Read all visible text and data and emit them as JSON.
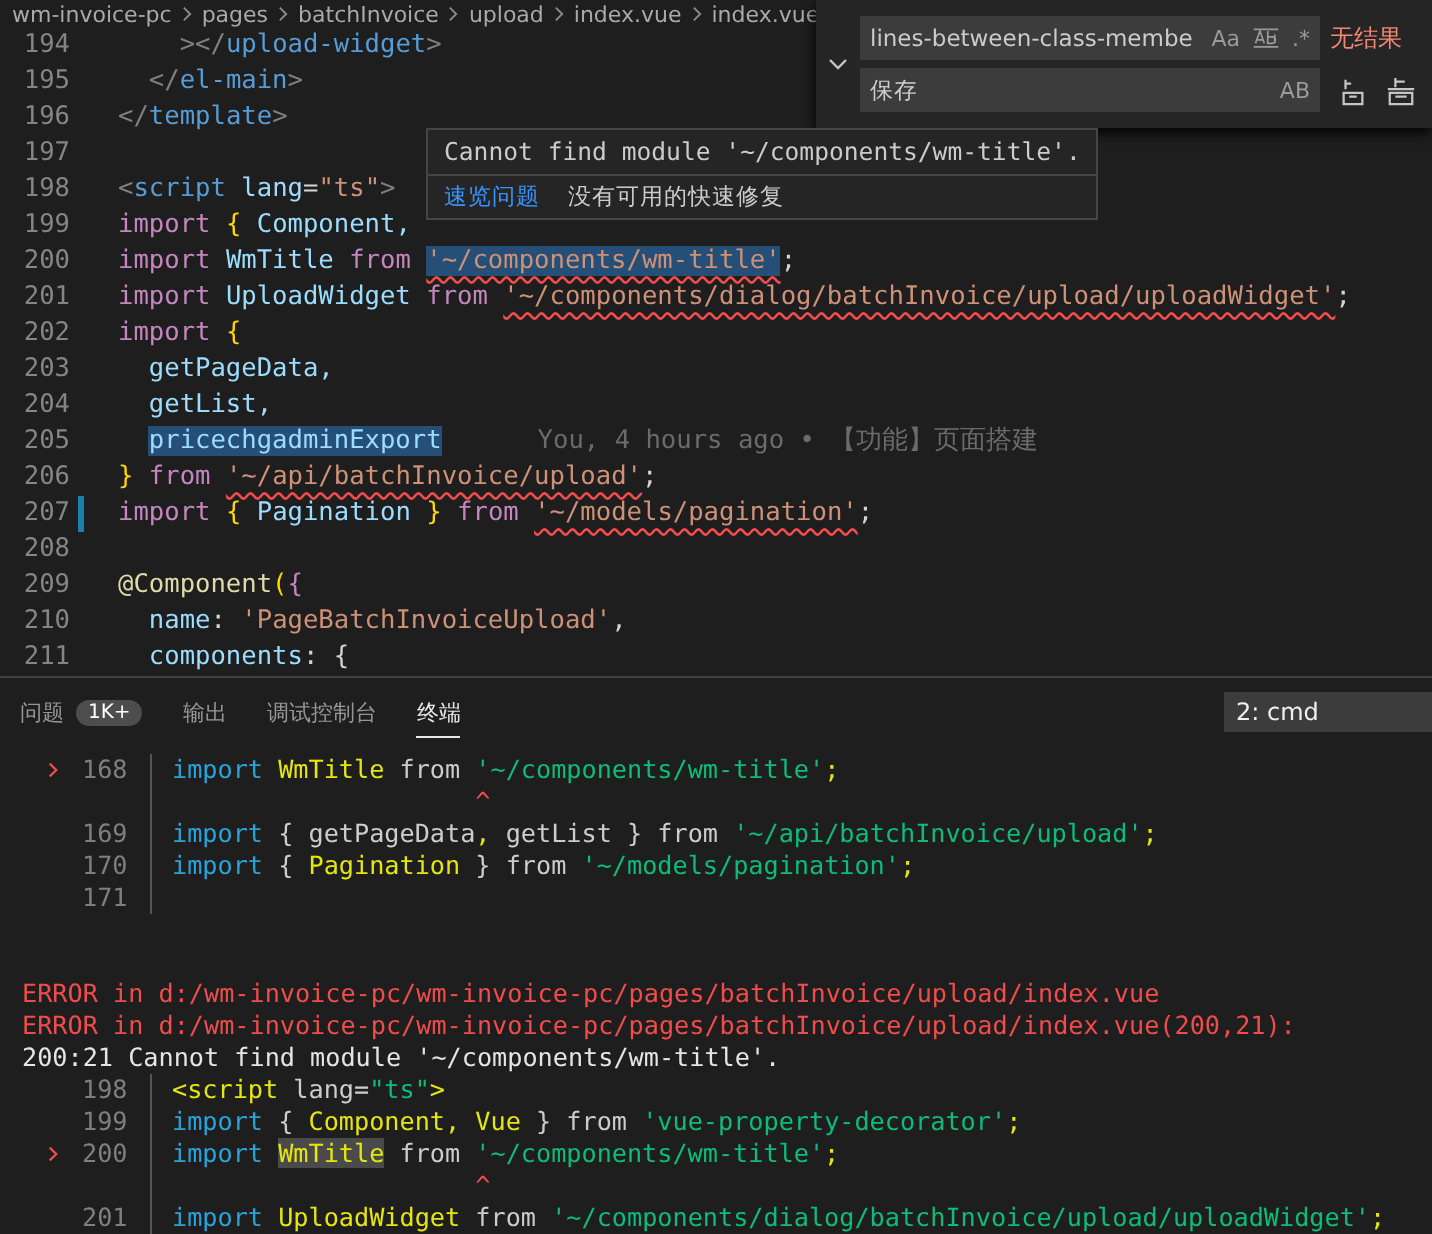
{
  "breadcrumb": [
    "wm-invoice-pc",
    "pages",
    "batchInvoice",
    "upload",
    "index.vue",
    "index.vue"
  ],
  "editor": {
    "lines": [
      {
        "num": "194",
        "modified": false,
        "tokens": [
          {
            "text": "    >",
            "kind": "angle"
          },
          {
            "text": "</",
            "kind": "angle"
          },
          {
            "text": "upload-widget",
            "kind": "tag"
          },
          {
            "text": ">",
            "kind": "angle"
          }
        ]
      },
      {
        "num": "195",
        "modified": false,
        "tokens": [
          {
            "text": "  </",
            "kind": "angle"
          },
          {
            "text": "el-main",
            "kind": "tag"
          },
          {
            "text": ">",
            "kind": "angle"
          }
        ]
      },
      {
        "num": "196",
        "modified": false,
        "tokens": [
          {
            "text": "</",
            "kind": "angle"
          },
          {
            "text": "template",
            "kind": "tag"
          },
          {
            "text": ">",
            "kind": "angle"
          }
        ]
      },
      {
        "num": "197",
        "modified": false
      },
      {
        "num": "198",
        "modified": false,
        "tokens": [
          {
            "text": "<",
            "kind": "angle"
          },
          {
            "text": "script",
            "kind": "tag"
          },
          {
            "text": " lang",
            "kind": "var"
          },
          {
            "text": "=",
            "kind": "punct"
          },
          {
            "text": "\"ts\"",
            "kind": "str"
          },
          {
            "text": ">",
            "kind": "angle"
          }
        ]
      },
      {
        "num": "199",
        "modified": false,
        "tokens": [
          {
            "text": "import",
            "kind": "kw"
          },
          {
            "text": " {",
            "kind": "brace"
          },
          {
            "text": " Component,",
            "kind": "var"
          }
        ]
      },
      {
        "num": "200",
        "modified": false,
        "tokens": [
          {
            "text": "import",
            "kind": "kw"
          },
          {
            "text": " WmTitle ",
            "kind": "var"
          },
          {
            "text": "from ",
            "kind": "kw"
          },
          {
            "text": "'~/components/wm-title'",
            "kind": "str-hover"
          },
          {
            "text": ";",
            "kind": "punct"
          }
        ]
      },
      {
        "num": "201",
        "modified": false,
        "tokens": [
          {
            "text": "import",
            "kind": "kw"
          },
          {
            "text": " UploadWidget ",
            "kind": "var"
          },
          {
            "text": "from ",
            "kind": "kw"
          },
          {
            "text": "'~/components/dialog/batchInvoice/upload/uploadWidget'",
            "kind": "str-err"
          },
          {
            "text": ";",
            "kind": "punct"
          }
        ]
      },
      {
        "num": "202",
        "modified": false,
        "tokens": [
          {
            "text": "import",
            "kind": "kw"
          },
          {
            "text": " {",
            "kind": "brace"
          }
        ]
      },
      {
        "num": "203",
        "modified": false,
        "tokens": [
          {
            "text": "  getPageData,",
            "kind": "var"
          }
        ]
      },
      {
        "num": "204",
        "modified": false,
        "tokens": [
          {
            "text": "  getList,",
            "kind": "var"
          }
        ]
      },
      {
        "num": "205",
        "modified": false,
        "tokens": [
          {
            "text": "pricechgadminExport",
            "kind": "sel"
          }
        ],
        "blame": "You, 4 hours ago • 【功能】页面搭建"
      },
      {
        "num": "206",
        "modified": false,
        "tokens": [
          {
            "text": "}",
            "kind": "brace"
          },
          {
            "text": " from ",
            "kind": "kw"
          },
          {
            "text": "'~/api/batchInvoice/upload'",
            "kind": "str-err"
          },
          {
            "text": ";",
            "kind": "punct"
          }
        ]
      },
      {
        "num": "207",
        "modified": true,
        "tokens": [
          {
            "text": "import",
            "kind": "kw"
          },
          {
            "text": " {",
            "kind": "brace"
          },
          {
            "text": " Pagination ",
            "kind": "var"
          },
          {
            "text": "}",
            "kind": "brace"
          },
          {
            "text": " from ",
            "kind": "kw"
          },
          {
            "text": "'~/models/pagination'",
            "kind": "str-err"
          },
          {
            "text": ";",
            "kind": "punct"
          }
        ]
      },
      {
        "num": "208",
        "modified": false
      },
      {
        "num": "209",
        "modified": false,
        "tokens": [
          {
            "text": "@Component",
            "kind": "fn"
          },
          {
            "text": "(",
            "kind": "brace"
          },
          {
            "text": "{",
            "kind": "kw"
          }
        ]
      },
      {
        "num": "210",
        "modified": false,
        "tokens": [
          {
            "text": "  name",
            "kind": "var"
          },
          {
            "text": ": ",
            "kind": "punct"
          },
          {
            "text": "'PageBatchInvoiceUpload'",
            "kind": "str"
          },
          {
            "text": ",",
            "kind": "punct"
          }
        ]
      },
      {
        "num": "211",
        "modified": false,
        "tokens": [
          {
            "text": "  components",
            "kind": "var"
          },
          {
            "text": ": {",
            "kind": "punct"
          }
        ]
      }
    ]
  },
  "hover": {
    "message": "Cannot find module '~/components/wm-title'.",
    "link": "速览问题",
    "note": "没有可用的快速修复"
  },
  "find": {
    "value": "lines-between-class-membe",
    "case_label": "Aa",
    "regex_label": ".*",
    "result": "无结果",
    "replace_value": "保存",
    "preserve_case_label": "AB"
  },
  "panel": {
    "tabs": [
      {
        "label": "问题",
        "badge": "1K+",
        "selected": false
      },
      {
        "label": "输出",
        "selected": false
      },
      {
        "label": "调试控制台",
        "selected": false
      },
      {
        "label": "终端",
        "selected": true
      }
    ],
    "terminal_select": "2: cmd",
    "lines": [
      {
        "kind": "code",
        "marker": true,
        "num": "168",
        "tokens": [
          {
            "text": "import",
            "kind": "kw"
          },
          {
            "text": " WmTitle",
            "kind": "id"
          },
          {
            "text": " from ",
            "kind": "txt"
          },
          {
            "text": "'~/components/wm-title'",
            "kind": "str"
          },
          {
            "text": ";",
            "kind": "id"
          }
        ]
      },
      {
        "kind": "caret",
        "text": "                    ^"
      },
      {
        "kind": "code",
        "marker": false,
        "num": "169",
        "tokens": [
          {
            "text": "import",
            "kind": "kw"
          },
          {
            "text": " { getPageData",
            "kind": "txt"
          },
          {
            "text": ",",
            "kind": "id"
          },
          {
            "text": " getList } from ",
            "kind": "txt"
          },
          {
            "text": "'~/api/batchInvoice/upload'",
            "kind": "str"
          },
          {
            "text": ";",
            "kind": "id"
          }
        ]
      },
      {
        "kind": "code",
        "marker": false,
        "num": "170",
        "tokens": [
          {
            "text": "import",
            "kind": "kw"
          },
          {
            "text": " { ",
            "kind": "txt"
          },
          {
            "text": "Pagination",
            "kind": "id"
          },
          {
            "text": " } from ",
            "kind": "txt"
          },
          {
            "text": "'~/models/pagination'",
            "kind": "str"
          },
          {
            "text": ";",
            "kind": "id"
          }
        ]
      },
      {
        "kind": "code",
        "marker": false,
        "num": "171"
      },
      {
        "kind": "blank"
      },
      {
        "kind": "blank"
      },
      {
        "kind": "error",
        "text": "ERROR in d:/wm-invoice-pc/wm-invoice-pc/pages/batchInvoice/upload/index.vue"
      },
      {
        "kind": "error",
        "text": "ERROR in d:/wm-invoice-pc/wm-invoice-pc/pages/batchInvoice/upload/index.vue(200,21):"
      },
      {
        "kind": "message",
        "text": "200:21 Cannot find module '~/components/wm-title'."
      },
      {
        "kind": "code",
        "marker": false,
        "num": "198",
        "tokens": [
          {
            "text": "<script",
            "kind": "id"
          },
          {
            "text": " lang=",
            "kind": "txt"
          },
          {
            "text": "\"ts\"",
            "kind": "str"
          },
          {
            "text": ">",
            "kind": "id"
          }
        ]
      },
      {
        "kind": "code",
        "marker": false,
        "num": "199",
        "tokens": [
          {
            "text": "import",
            "kind": "kw"
          },
          {
            "text": " { ",
            "kind": "txt"
          },
          {
            "text": "Component, Vue",
            "kind": "id"
          },
          {
            "text": " } from ",
            "kind": "txt"
          },
          {
            "text": "'vue-property-decorator'",
            "kind": "str"
          },
          {
            "text": ";",
            "kind": "id"
          }
        ]
      },
      {
        "kind": "code",
        "marker": true,
        "num": "200",
        "tokens": [
          {
            "text": "import",
            "kind": "kw"
          },
          {
            "text": "WmTitle",
            "kind": "hl"
          },
          {
            "text": " from ",
            "kind": "txt"
          },
          {
            "text": "'~/components/wm-title'",
            "kind": "str"
          },
          {
            "text": ";",
            "kind": "id"
          }
        ]
      },
      {
        "kind": "caret",
        "text": "                    ^"
      },
      {
        "kind": "code",
        "marker": false,
        "num": "201",
        "tokens": [
          {
            "text": "import",
            "kind": "kw"
          },
          {
            "text": " UploadWidget",
            "kind": "id"
          },
          {
            "text": " from ",
            "kind": "txt"
          },
          {
            "text": "'~/components/dialog/batchInvoice/upload/uploadWidget'",
            "kind": "str"
          },
          {
            "text": ";",
            "kind": "id"
          }
        ]
      }
    ]
  }
}
